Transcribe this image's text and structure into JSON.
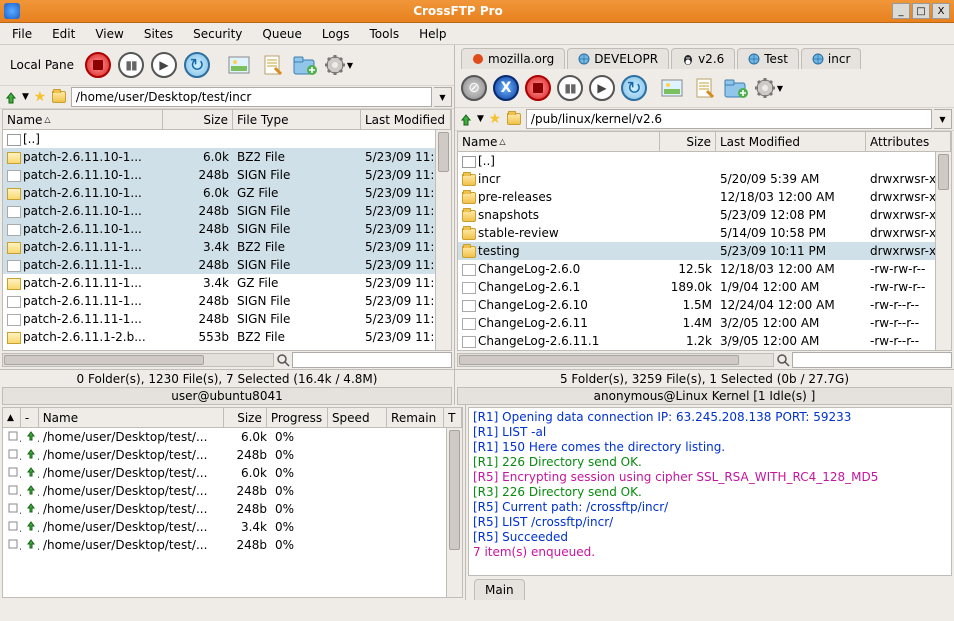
{
  "title": "CrossFTP Pro",
  "menu": [
    "File",
    "Edit",
    "View",
    "Sites",
    "Security",
    "Queue",
    "Logs",
    "Tools",
    "Help"
  ],
  "win_btns": {
    "min": "_",
    "max": "□",
    "close": "X"
  },
  "local_label": "Local Pane",
  "local_path": "/home/user/Desktop/test/incr",
  "remote_path": "/pub/linux/kernel/v2.6",
  "remote_tabs": [
    {
      "label": "mozilla.org",
      "icon": "moz"
    },
    {
      "label": "DEVELOPR",
      "icon": "globe"
    },
    {
      "label": "v2.6",
      "icon": "tux"
    },
    {
      "label": "Test",
      "icon": "globe"
    },
    {
      "label": "incr",
      "icon": "globe"
    }
  ],
  "local_cols": {
    "name": "Name",
    "size": "Size",
    "type": "File Type",
    "mod": "Last Modified"
  },
  "remote_cols": {
    "name": "Name",
    "size": "Size",
    "mod": "Last Modified",
    "attr": "Attributes"
  },
  "local_status": "0 Folder(s), 1230 File(s), 7 Selected (16.4k / 4.8M)",
  "remote_status": "5 Folder(s), 3259 File(s), 1 Selected (0b / 27.7G)",
  "local_user": "user@ubuntu8041",
  "remote_user": "anonymous@Linux Kernel [1 Idle(s) ]",
  "parent_label": "[..]",
  "find_ph": "",
  "local_files": [
    {
      "sel": true,
      "ic": "arch",
      "name": "patch-2.6.11.10-1...",
      "size": "6.0k",
      "type": "BZ2 File",
      "mod": "5/23/09 11:"
    },
    {
      "sel": true,
      "ic": "file",
      "name": "patch-2.6.11.10-1...",
      "size": "248b",
      "type": "SIGN File",
      "mod": "5/23/09 11:"
    },
    {
      "sel": true,
      "ic": "arch",
      "name": "patch-2.6.11.10-1...",
      "size": "6.0k",
      "type": "GZ File",
      "mod": "5/23/09 11:"
    },
    {
      "sel": true,
      "ic": "file",
      "name": "patch-2.6.11.10-1...",
      "size": "248b",
      "type": "SIGN File",
      "mod": "5/23/09 11:"
    },
    {
      "sel": true,
      "ic": "file",
      "name": "patch-2.6.11.10-1...",
      "size": "248b",
      "type": "SIGN File",
      "mod": "5/23/09 11:"
    },
    {
      "sel": true,
      "ic": "arch",
      "name": "patch-2.6.11.11-1...",
      "size": "3.4k",
      "type": "BZ2 File",
      "mod": "5/23/09 11:"
    },
    {
      "sel": true,
      "ic": "file",
      "name": "patch-2.6.11.11-1...",
      "size": "248b",
      "type": "SIGN File",
      "mod": "5/23/09 11:"
    },
    {
      "sel": false,
      "ic": "arch",
      "name": "patch-2.6.11.11-1...",
      "size": "3.4k",
      "type": "GZ File",
      "mod": "5/23/09 11:"
    },
    {
      "sel": false,
      "ic": "file",
      "name": "patch-2.6.11.11-1...",
      "size": "248b",
      "type": "SIGN File",
      "mod": "5/23/09 11:"
    },
    {
      "sel": false,
      "ic": "file",
      "name": "patch-2.6.11.11-1...",
      "size": "248b",
      "type": "SIGN File",
      "mod": "5/23/09 11:"
    },
    {
      "sel": false,
      "ic": "arch",
      "name": "patch-2.6.11.1-2.b...",
      "size": "553b",
      "type": "BZ2 File",
      "mod": "5/23/09 11:"
    }
  ],
  "remote_files": [
    {
      "sel": false,
      "ic": "folder",
      "name": "incr",
      "size": "",
      "mod": "5/20/09 5:39 AM",
      "attr": "drwxrwsr-x"
    },
    {
      "sel": false,
      "ic": "folder",
      "name": "pre-releases",
      "size": "",
      "mod": "12/18/03 12:00 AM",
      "attr": "drwxrwsr-x"
    },
    {
      "sel": false,
      "ic": "folder",
      "name": "snapshots",
      "size": "",
      "mod": "5/23/09 12:08 PM",
      "attr": "drwxrwsr-x"
    },
    {
      "sel": false,
      "ic": "folder",
      "name": "stable-review",
      "size": "",
      "mod": "5/14/09 10:58 PM",
      "attr": "drwxrwsr-x"
    },
    {
      "sel": true,
      "ic": "folder",
      "name": "testing",
      "size": "",
      "mod": "5/23/09 10:11 PM",
      "attr": "drwxrwsr-x"
    },
    {
      "sel": false,
      "ic": "file",
      "name": "ChangeLog-2.6.0",
      "size": "12.5k",
      "mod": "12/18/03 12:00 AM",
      "attr": "-rw-rw-r--"
    },
    {
      "sel": false,
      "ic": "file",
      "name": "ChangeLog-2.6.1",
      "size": "189.0k",
      "mod": "1/9/04 12:00 AM",
      "attr": "-rw-rw-r--"
    },
    {
      "sel": false,
      "ic": "file",
      "name": "ChangeLog-2.6.10",
      "size": "1.5M",
      "mod": "12/24/04 12:00 AM",
      "attr": "-rw-r--r--"
    },
    {
      "sel": false,
      "ic": "file",
      "name": "ChangeLog-2.6.11",
      "size": "1.4M",
      "mod": "3/2/05 12:00 AM",
      "attr": "-rw-r--r--"
    },
    {
      "sel": false,
      "ic": "file",
      "name": "ChangeLog-2.6.11.1",
      "size": "1.2k",
      "mod": "3/9/05 12:00 AM",
      "attr": "-rw-r--r--"
    }
  ],
  "queue_cols": {
    "name": "Name",
    "size": "Size",
    "prog": "Progress",
    "speed": "Speed",
    "rem": "Remain",
    "t": "T"
  },
  "queue": [
    {
      "name": "/home/user/Desktop/test/...",
      "size": "6.0k",
      "prog": "0%"
    },
    {
      "name": "/home/user/Desktop/test/...",
      "size": "248b",
      "prog": "0%"
    },
    {
      "name": "/home/user/Desktop/test/...",
      "size": "6.0k",
      "prog": "0%"
    },
    {
      "name": "/home/user/Desktop/test/...",
      "size": "248b",
      "prog": "0%"
    },
    {
      "name": "/home/user/Desktop/test/...",
      "size": "248b",
      "prog": "0%"
    },
    {
      "name": "/home/user/Desktop/test/...",
      "size": "3.4k",
      "prog": "0%"
    },
    {
      "name": "/home/user/Desktop/test/...",
      "size": "248b",
      "prog": "0%"
    }
  ],
  "log": [
    {
      "c": "blue",
      "t": "[R1] Opening data connection IP: 63.245.208.138 PORT: 59233"
    },
    {
      "c": "blue",
      "t": "[R1] LIST -al"
    },
    {
      "c": "blue",
      "t": "[R1] 150 Here comes the directory listing."
    },
    {
      "c": "green",
      "t": "[R1] 226 Directory send OK."
    },
    {
      "c": "mag",
      "t": "[R5] Encrypting session using cipher SSL_RSA_WITH_RC4_128_MD5"
    },
    {
      "c": "green",
      "t": "[R3] 226 Directory send OK."
    },
    {
      "c": "blue",
      "t": "[R5] Current path: /crossftp/incr/"
    },
    {
      "c": "blue",
      "t": "[R5] LIST /crossftp/incr/"
    },
    {
      "c": "blue",
      "t": "[R5] Succeeded"
    },
    {
      "c": "mag",
      "t": "7 item(s) enqueued."
    }
  ],
  "main_tab": "Main"
}
